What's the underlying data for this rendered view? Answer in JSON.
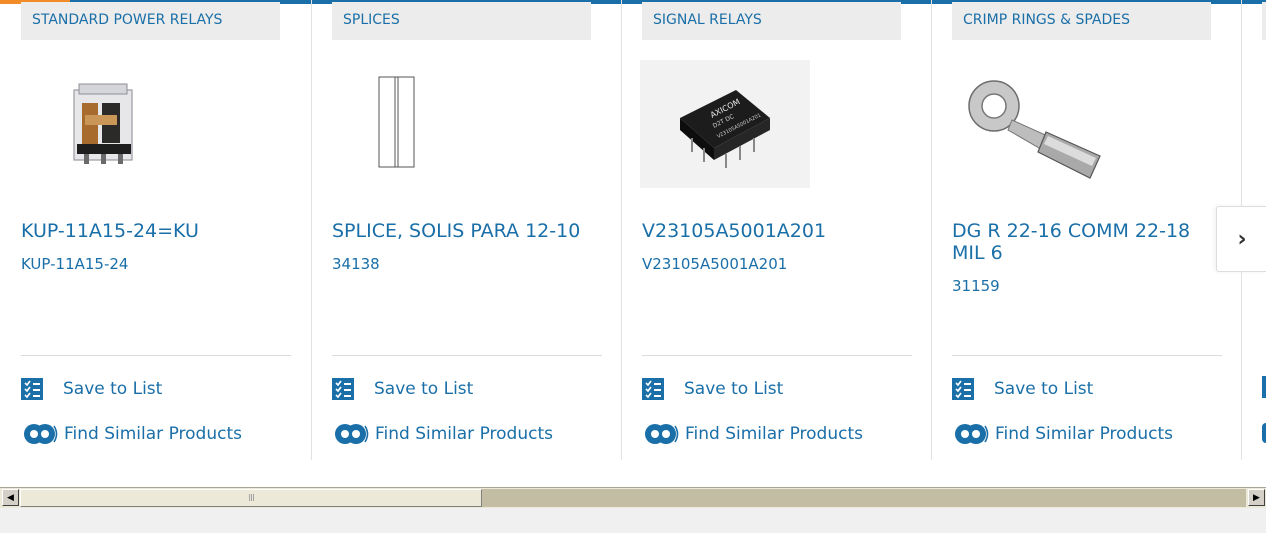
{
  "colors": {
    "link": "#1a6fa8",
    "accent_bar": "#1a6fa8",
    "accent_orange": "#f28c28",
    "header_bg": "#ececec"
  },
  "products": [
    {
      "category": "STANDARD POWER RELAYS",
      "title": "KUP-11A15-24=KU",
      "part_number": "KUP-11A15-24",
      "image_icon": "relay-cube-icon",
      "save_label": "Save to List",
      "similar_label": "Find Similar Products"
    },
    {
      "category": "SPLICES",
      "title": "SPLICE, SOLIS PARA 12-10",
      "part_number": "34138",
      "image_icon": "splice-drawing-icon",
      "save_label": "Save to List",
      "similar_label": "Find Similar Products"
    },
    {
      "category": "SIGNAL RELAYS",
      "title": "V23105A5001A201",
      "part_number": "V23105A5001A201",
      "image_icon": "signal-relay-icon",
      "image_text": {
        "brand": "AXICOM",
        "code": "D2T DC",
        "model": "V23105A5001A201"
      },
      "save_label": "Save to List",
      "similar_label": "Find Similar Products"
    },
    {
      "category": "CRIMP RINGS & SPADES",
      "title": "DG R 22-16 COMM 22-18 MIL 6",
      "part_number": "31159",
      "image_icon": "ring-terminal-icon",
      "save_label": "Save to List",
      "similar_label": "Find Similar Products"
    }
  ],
  "carousel": {
    "next_icon": "chevron-right-icon",
    "next_glyph": "›"
  },
  "scrollbar": {
    "left_glyph": "◀",
    "right_glyph": "▶",
    "thumb_grip": "III"
  }
}
